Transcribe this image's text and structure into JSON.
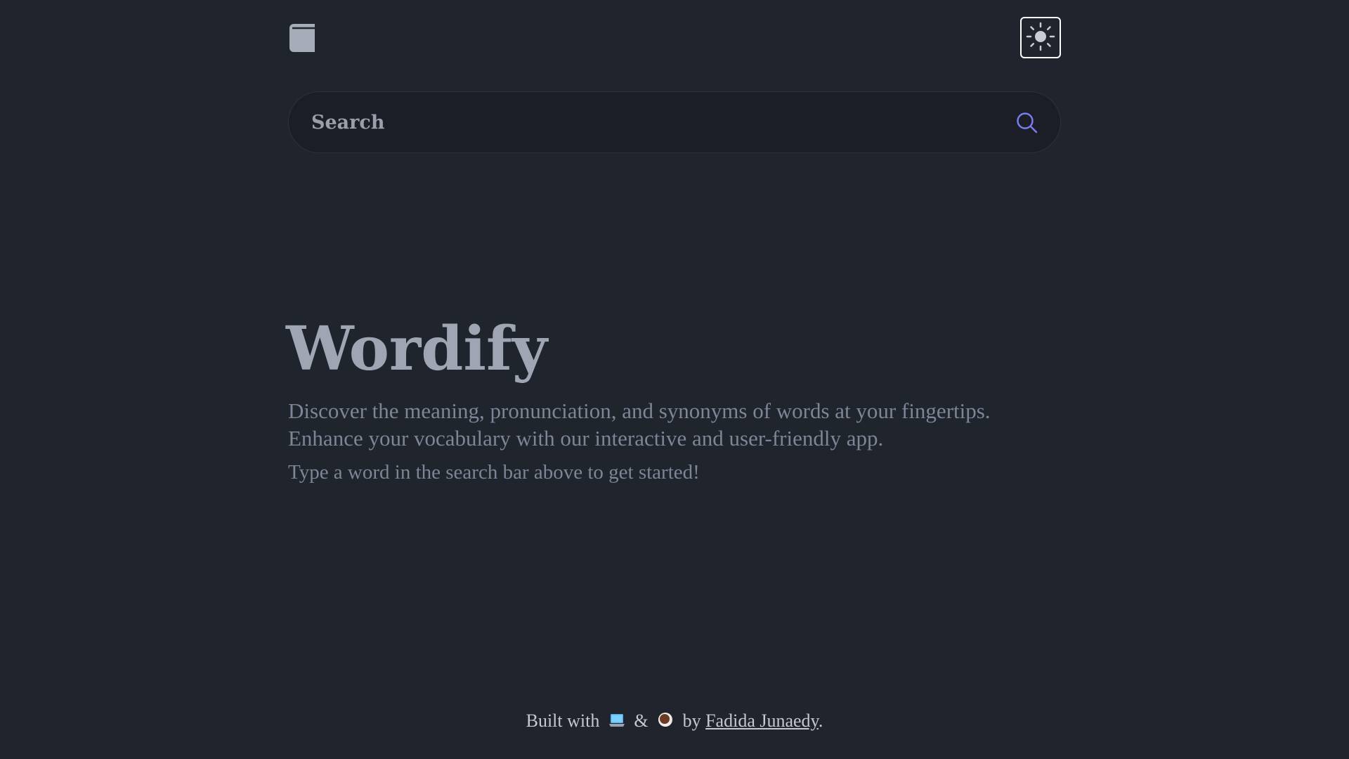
{
  "header": {
    "logo_icon": "book-icon",
    "theme_toggle_icon": "sun-icon"
  },
  "search": {
    "placeholder": "Search",
    "value": "",
    "button_icon": "search-icon",
    "accent_color": "#7b7ff5"
  },
  "hero": {
    "title": "Wordify",
    "description": "Discover the meaning, pronunciation, and synonyms of words at your fingertips. Enhance your vocabulary with our interactive and user-friendly app.",
    "hint": "Type a word in the search bar above to get started!"
  },
  "footer": {
    "built_with": "Built with",
    "laptop_icon": "laptop-icon",
    "and": "&",
    "coffee_icon": "coffee-icon",
    "by": "by",
    "author": "Fadida Junaedy",
    "period": "."
  },
  "colors": {
    "background": "#1f242d",
    "search_background": "#1b1e26",
    "title": "#9fa5b2",
    "body_text": "#7d8596",
    "accent": "#7b7ff5"
  }
}
